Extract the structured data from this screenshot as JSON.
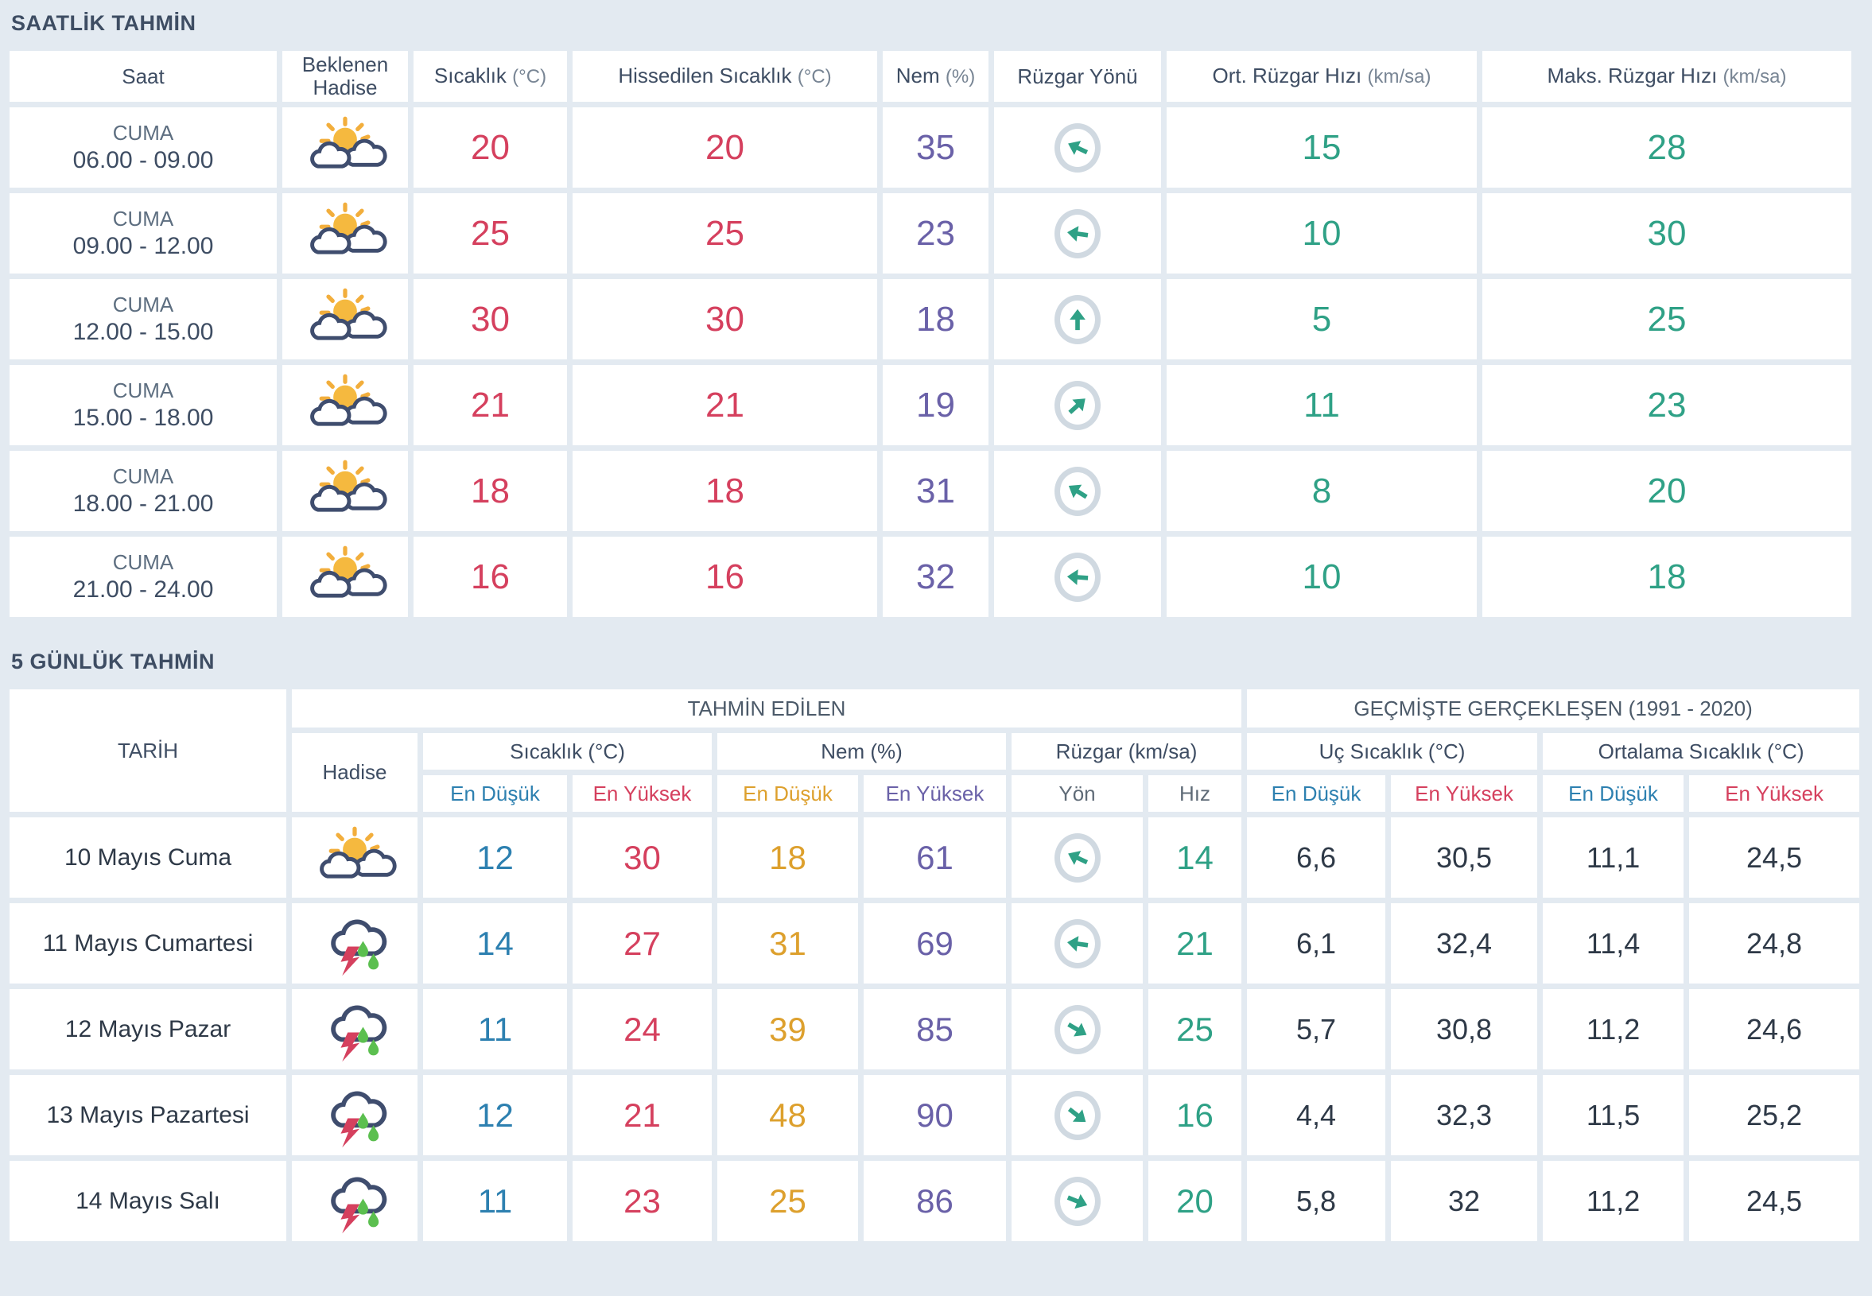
{
  "hourly": {
    "title": "SAATLİK TAHMİN",
    "columns": {
      "saat": "Saat",
      "hadise_l1": "Beklenen",
      "hadise_l2": "Hadise",
      "sicaklik": "Sıcaklık",
      "sicaklik_unit": "(°C)",
      "hissedilen": "Hissedilen Sıcaklık",
      "hissedilen_unit": "(°C)",
      "nem": "Nem",
      "nem_unit": "(%)",
      "ruzgar_yonu": "Rüzgar Yönü",
      "ort_ruzgar": "Ort. Rüzgar Hızı",
      "ort_ruzgar_unit": "(km/sa)",
      "maks_ruzgar": "Maks. Rüzgar Hızı",
      "maks_ruzgar_unit": "(km/sa)"
    },
    "rows": [
      {
        "day": "CUMA",
        "time": "06.00 - 09.00",
        "icon": "partly-cloudy",
        "condition": "parçalı bulutlu",
        "temp": "20",
        "feels": "20",
        "humidity": "35",
        "wind_dir": "southwest",
        "wind_deg": 205,
        "wind_avg": "15",
        "wind_max": "28"
      },
      {
        "day": "CUMA",
        "time": "09.00 - 12.00",
        "icon": "partly-cloudy",
        "condition": "parçalı bulutlu",
        "temp": "25",
        "feels": "25",
        "humidity": "23",
        "wind_dir": "west",
        "wind_deg": 188,
        "wind_avg": "10",
        "wind_max": "30"
      },
      {
        "day": "CUMA",
        "time": "12.00 - 15.00",
        "icon": "partly-cloudy",
        "condition": "parçalı bulutlu",
        "temp": "30",
        "feels": "30",
        "humidity": "18",
        "wind_dir": "north",
        "wind_deg": 270,
        "wind_avg": "5",
        "wind_max": "25"
      },
      {
        "day": "CUMA",
        "time": "15.00 - 18.00",
        "icon": "partly-cloudy",
        "condition": "parçalı bulutlu",
        "temp": "21",
        "feels": "21",
        "humidity": "19",
        "wind_dir": "northeast",
        "wind_deg": 318,
        "wind_avg": "11",
        "wind_max": "23"
      },
      {
        "day": "CUMA",
        "time": "18.00 - 21.00",
        "icon": "partly-cloudy",
        "condition": "parçalı bulutlu",
        "temp": "18",
        "feels": "18",
        "humidity": "31",
        "wind_dir": "southwest",
        "wind_deg": 212,
        "wind_avg": "8",
        "wind_max": "20"
      },
      {
        "day": "CUMA",
        "time": "21.00 - 24.00",
        "icon": "partly-cloudy",
        "condition": "parçalı bulutlu",
        "temp": "16",
        "feels": "16",
        "humidity": "32",
        "wind_dir": "west",
        "wind_deg": 184,
        "wind_avg": "10",
        "wind_max": "18"
      }
    ]
  },
  "daily": {
    "title": "5 GÜNLÜK TAHMİN",
    "group_headers": {
      "tarih": "TARİH",
      "tahmin": "TAHMİN EDİLEN",
      "gecmis": "GEÇMİŞTE GERÇEKLEŞEN (1991 - 2020)"
    },
    "mid_headers": {
      "hadise": "Hadise",
      "sicaklik": "Sıcaklık (°C)",
      "nem": "Nem (%)",
      "ruzgar": "Rüzgar (km/sa)",
      "uc_sicaklik": "Uç Sıcaklık (°C)",
      "ortalama_sicaklik": "Ortalama Sıcaklık (°C)"
    },
    "sub_headers": {
      "en_dusuk": "En Düşük",
      "en_yuksek": "En Yüksek",
      "yon": "Yön",
      "hiz": "Hız"
    },
    "rows": [
      {
        "date": "10 Mayıs Cuma",
        "icon": "partly-cloudy",
        "condition": "parçalı bulutlu",
        "temp_min": "12",
        "temp_max": "30",
        "hum_min": "18",
        "hum_max": "61",
        "wind_dir": "southwest",
        "wind_deg": 205,
        "wind_speed": "14",
        "ext_min": "6,6",
        "ext_max": "30,5",
        "avg_min": "11,1",
        "avg_max": "24,5"
      },
      {
        "date": "11 Mayıs Cumartesi",
        "icon": "thunderstorm",
        "condition": "gök gürültülü sağanak yağışlı",
        "temp_min": "14",
        "temp_max": "27",
        "hum_min": "31",
        "hum_max": "69",
        "wind_dir": "west",
        "wind_deg": 188,
        "wind_speed": "21",
        "ext_min": "6,1",
        "ext_max": "32,4",
        "avg_min": "11,4",
        "avg_max": "24,8"
      },
      {
        "date": "12 Mayıs Pazar",
        "icon": "thunderstorm",
        "condition": "gök gürültülü sağanak yağışlı",
        "temp_min": "11",
        "temp_max": "24",
        "hum_min": "39",
        "hum_max": "85",
        "wind_dir": "southeast",
        "wind_deg": 30,
        "wind_speed": "25",
        "ext_min": "5,7",
        "ext_max": "30,8",
        "avg_min": "11,2",
        "avg_max": "24,6"
      },
      {
        "date": "13 Mayıs Pazartesi",
        "icon": "thunderstorm",
        "condition": "gök gürültülü sağanak yağışlı",
        "temp_min": "12",
        "temp_max": "21",
        "hum_min": "48",
        "hum_max": "90",
        "wind_dir": "southeast",
        "wind_deg": 38,
        "wind_speed": "16",
        "ext_min": "4,4",
        "ext_max": "32,3",
        "avg_min": "11,5",
        "avg_max": "25,2"
      },
      {
        "date": "14 Mayıs Salı",
        "icon": "thunderstorm",
        "condition": "gök gürültülü sağanak yağışlı",
        "temp_min": "11",
        "temp_max": "23",
        "hum_min": "25",
        "hum_max": "86",
        "wind_dir": "southeast",
        "wind_deg": 22,
        "wind_speed": "20",
        "ext_min": "5,8",
        "ext_max": "32",
        "avg_min": "11,2",
        "avg_max": "24,5"
      }
    ]
  },
  "colors": {
    "temperature": "#d5405e",
    "humidity": "#6a61a8",
    "wind": "#2fa186",
    "min": "#2d80b0",
    "humidity_min": "#dda02d",
    "background": "#e3eaf1"
  }
}
